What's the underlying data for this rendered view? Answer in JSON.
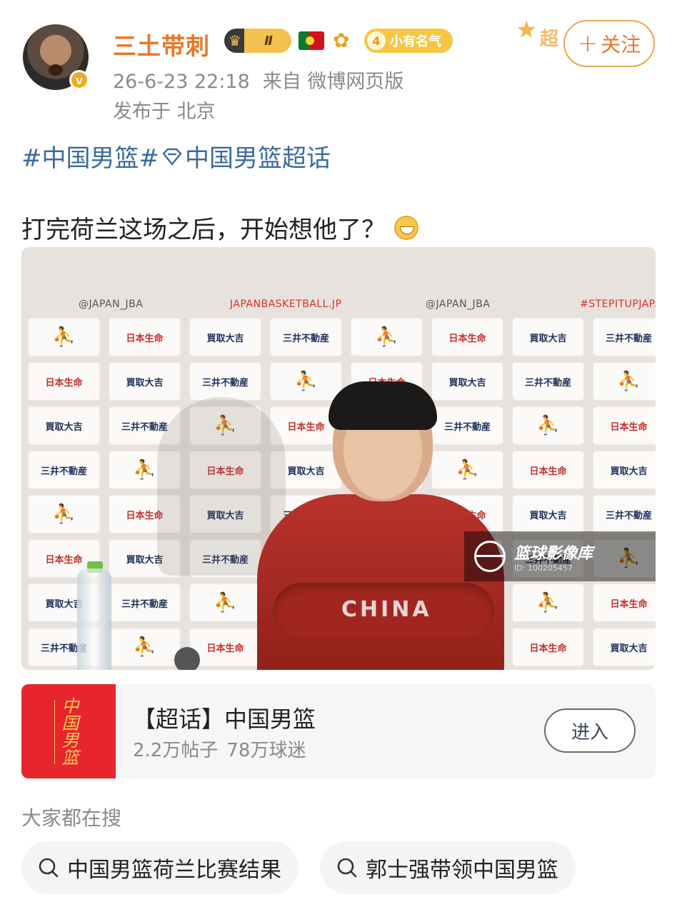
{
  "post": {
    "username": "三土带刺",
    "level_badge": "Ⅱ",
    "fame_level": "4",
    "fame_label": "小有名气",
    "timestamp": "26-6-23 22:18",
    "source": "来自 微博网页版",
    "location": "发布于 北京",
    "follow_label": "关注",
    "follow_plus": "+",
    "super_deco_text": "超",
    "hashtag_1": "#中国男篮#",
    "hashtag_2": "中国男篮超话",
    "body_text": "打完荷兰这场之后，开始想他了？"
  },
  "photo": {
    "backdrop_labels": [
      "@JAPAN_JBA",
      "JAPANBASKETBALL.JP",
      "@JAPAN_JBA",
      "#STEPITUPJAPA"
    ],
    "sponsors": [
      "日本生命",
      "買取大吉",
      "三井不動産"
    ],
    "jersey_text": "CHINA",
    "watermark_title": "篮球影像库",
    "watermark_id": "ID: 100205457"
  },
  "topic_card": {
    "cover_text": "中国男篮",
    "title": "【超话】中国男篮",
    "posts": "2.2万帖子",
    "fans": "78万球迷",
    "enter_label": "进入"
  },
  "searches": {
    "heading": "大家都在搜",
    "items": [
      "中国男篮荷兰比赛结果",
      "郭士强带领中国男篮"
    ]
  },
  "colors": {
    "username": "#e8782a",
    "hashtag": "#3a6b9f",
    "follow_border": "#e8a74b",
    "topic_cover": "#e8242c"
  }
}
